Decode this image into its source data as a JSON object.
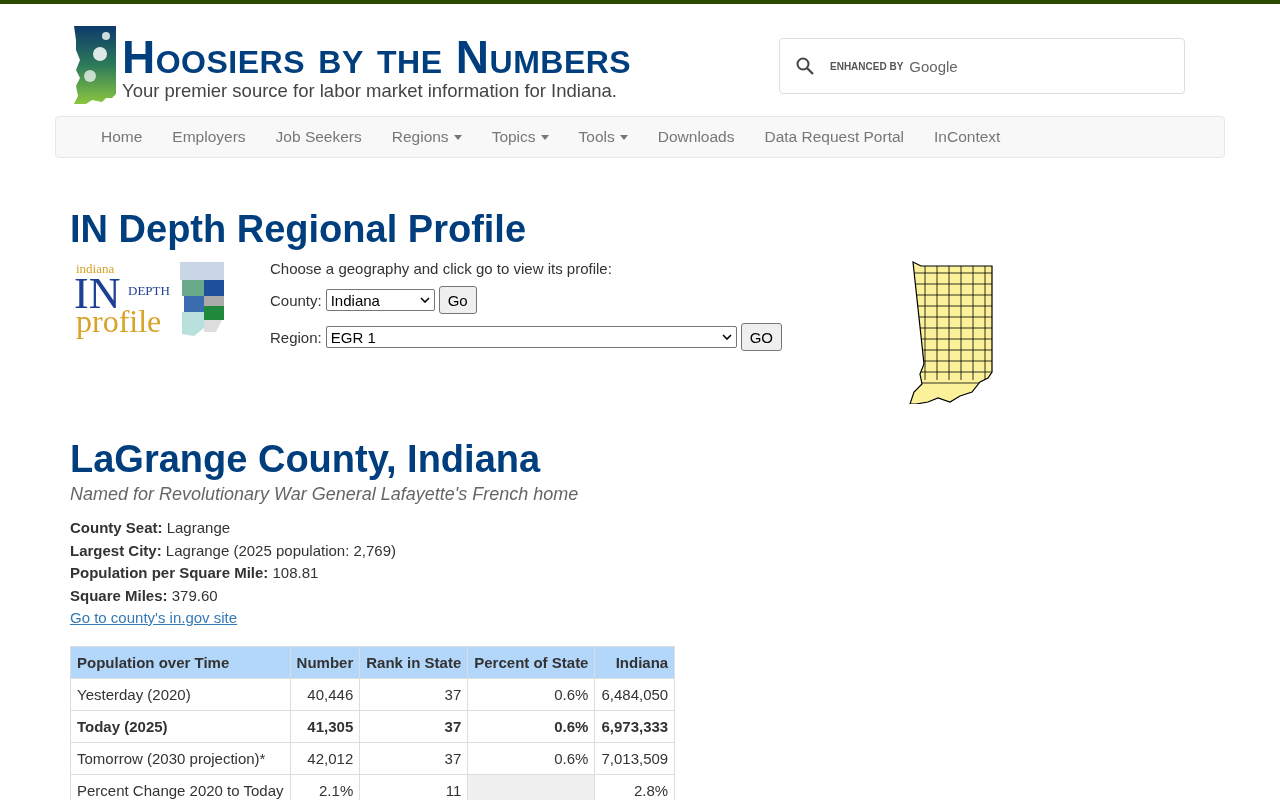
{
  "header": {
    "title": "Hoosiers by the Numbers",
    "tagline": "Your premier source for labor market information for Indiana.",
    "search": {
      "brand_prefix": "ENHANCED BY",
      "brand": "Google"
    }
  },
  "nav": [
    {
      "label": "Home",
      "dropdown": false
    },
    {
      "label": "Employers",
      "dropdown": false
    },
    {
      "label": "Job Seekers",
      "dropdown": false
    },
    {
      "label": "Regions",
      "dropdown": true
    },
    {
      "label": "Topics",
      "dropdown": true
    },
    {
      "label": "Tools",
      "dropdown": true
    },
    {
      "label": "Downloads",
      "dropdown": false
    },
    {
      "label": "Data Request Portal",
      "dropdown": false
    },
    {
      "label": "InContext",
      "dropdown": false
    }
  ],
  "page_title": "IN Depth Regional Profile",
  "profile_logo": {
    "top": "indiana",
    "big": "IN",
    "small": "DEPTH",
    "bottom": "profile"
  },
  "chooser": {
    "prompt": "Choose a geography and click go to view its profile:",
    "rows": [
      {
        "label": "County:",
        "value": "Indiana",
        "button": "Go",
        "wide": false
      },
      {
        "label": "Region:",
        "value": "EGR 1",
        "button": "GO",
        "wide": true
      }
    ]
  },
  "county": {
    "name": "LaGrange County, Indiana",
    "subtitle": "Named for Revolutionary War General Lafayette's French home",
    "facts": [
      {
        "label": "County Seat:",
        "value": "Lagrange"
      },
      {
        "label": "Largest City:",
        "value": "Lagrange (2025 population: 2,769)"
      },
      {
        "label": "Population per Square Mile:",
        "value": "108.81"
      },
      {
        "label": "Square Miles:",
        "value": "379.60"
      }
    ],
    "link": "Go to county's in.gov site"
  },
  "table": {
    "columns": [
      "Population over Time",
      "Number",
      "Rank in State",
      "Percent of State",
      "Indiana"
    ],
    "rows": [
      {
        "bold": false,
        "cells": [
          "Yesterday (2020)",
          "40,446",
          "37",
          "0.6%",
          "6,484,050"
        ]
      },
      {
        "bold": true,
        "cells": [
          "Today (2025)",
          "41,305",
          "37",
          "0.6%",
          "6,973,333"
        ]
      },
      {
        "bold": false,
        "cells": [
          "Tomorrow (2030 projection)*",
          "42,012",
          "37",
          "0.6%",
          "7,013,509"
        ]
      },
      {
        "bold": false,
        "cells": [
          "Percent Change 2020 to Today",
          "2.1%",
          "11",
          null,
          "2.8%"
        ]
      }
    ]
  }
}
